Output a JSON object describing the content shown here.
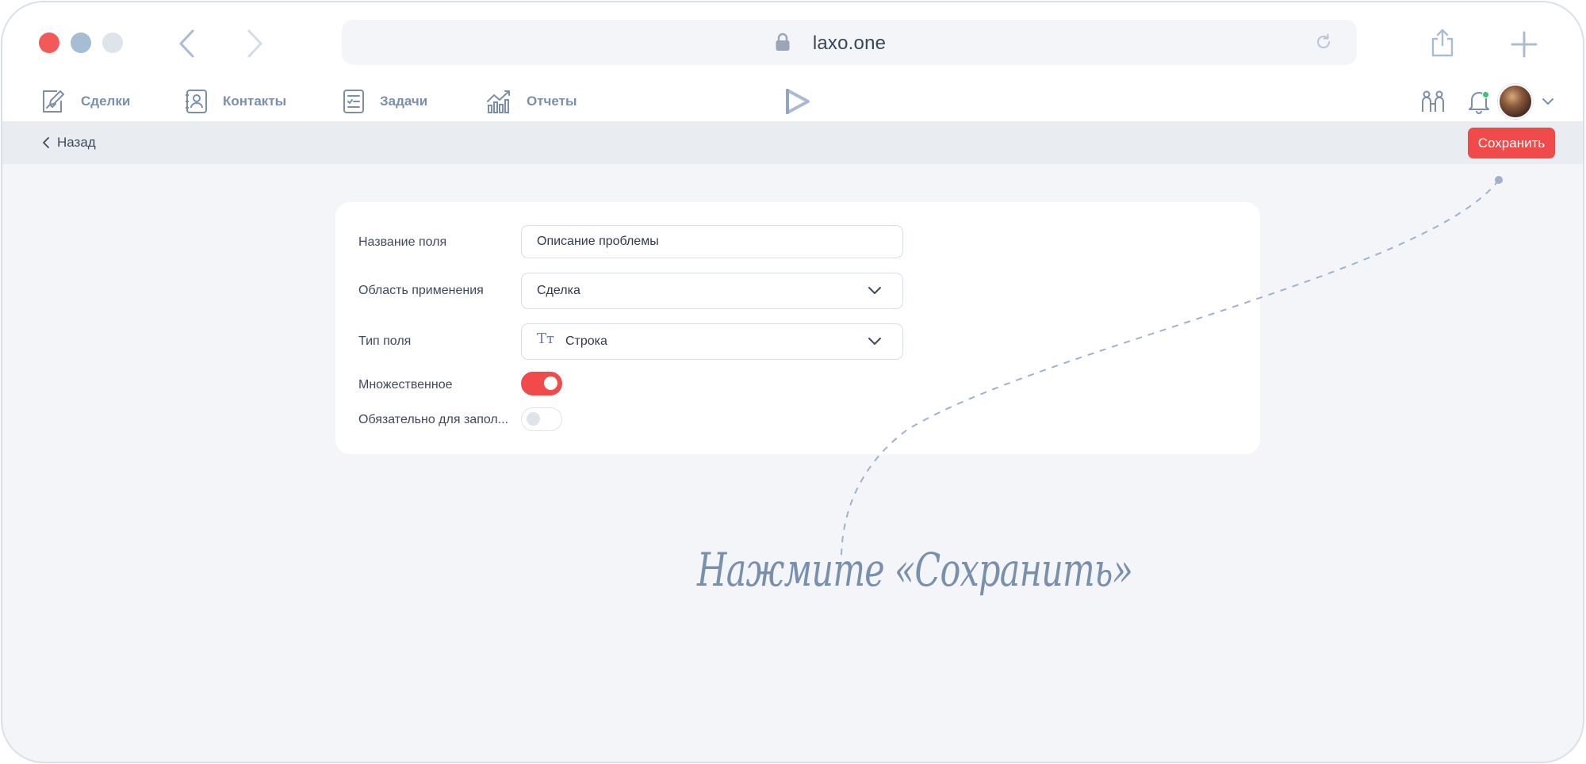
{
  "browser": {
    "url": "laxo.one",
    "icons": [
      "lock-icon",
      "reload-icon",
      "share-icon",
      "plus-icon",
      "back-arrow-icon",
      "forward-arrow-icon"
    ]
  },
  "nav": {
    "items": [
      {
        "label": "Сделки",
        "icon": "deals-icon"
      },
      {
        "label": "Контакты",
        "icon": "contacts-icon"
      },
      {
        "label": "Задачи",
        "icon": "tasks-icon"
      },
      {
        "label": "Отчеты",
        "icon": "reports-icon"
      }
    ]
  },
  "toolbar": {
    "back_label": "Назад",
    "save_label": "Сохранить"
  },
  "form": {
    "field_name_label": "Название поля",
    "field_name_value": "Описание проблемы",
    "scope_label": "Область применения",
    "scope_value": "Сделка",
    "type_label": "Тип поля",
    "type_icon_text": "Tт",
    "type_value": "Строка",
    "multiple_label": "Множественное",
    "multiple_on": true,
    "required_label": "Обязательно для запол...",
    "required_on": false
  },
  "annotation": {
    "text": "Нажмите «Сохранить»"
  },
  "colors": {
    "accent": "#f04a4a",
    "nav_text": "#7b8fac",
    "hint": "#7990ad",
    "online": "#3ec27a"
  }
}
